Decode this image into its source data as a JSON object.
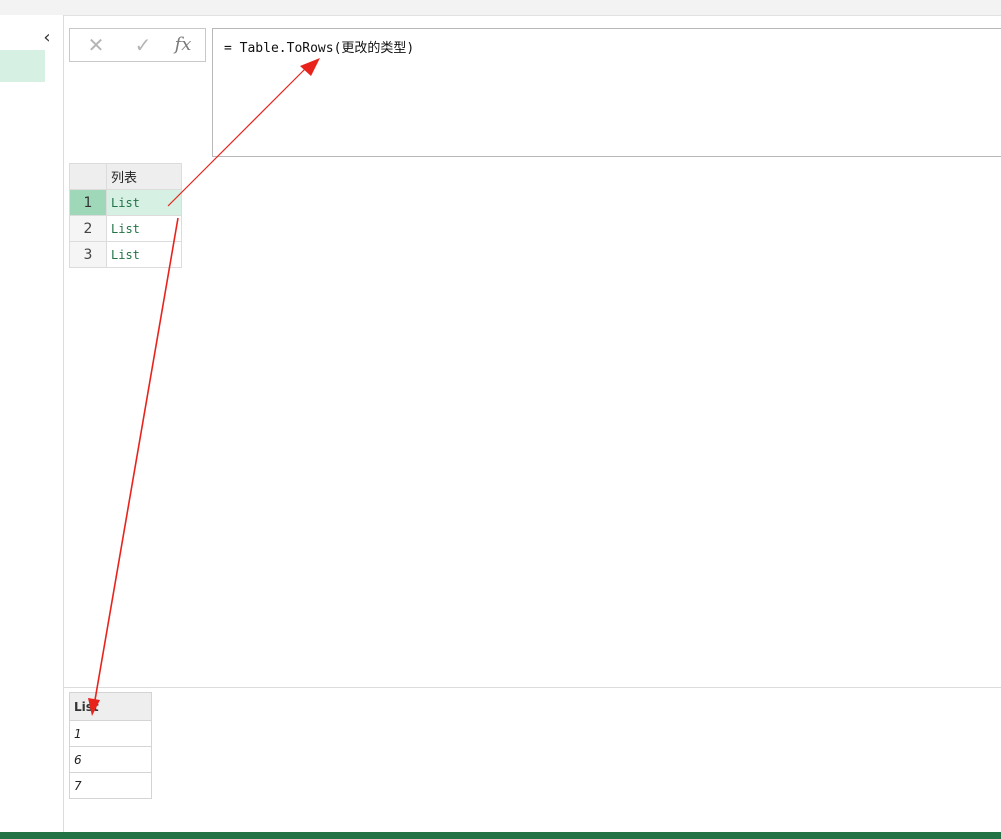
{
  "formula_bar": {
    "cancel_icon": "✕",
    "accept_icon": "✓",
    "fx_label": "fx",
    "formula": "= Table.ToRows(更改的类型)"
  },
  "left_pane": {
    "collapse_icon": "‹"
  },
  "grid": {
    "column_header": "列表",
    "rows": [
      {
        "num": "1",
        "value": "List"
      },
      {
        "num": "2",
        "value": "List"
      },
      {
        "num": "3",
        "value": "List"
      }
    ]
  },
  "preview": {
    "header": "List",
    "values": [
      "1",
      "6",
      "7"
    ]
  },
  "colors": {
    "accent": "#217346",
    "selection": "#d6f0e3",
    "annotation": "#e8231c"
  }
}
